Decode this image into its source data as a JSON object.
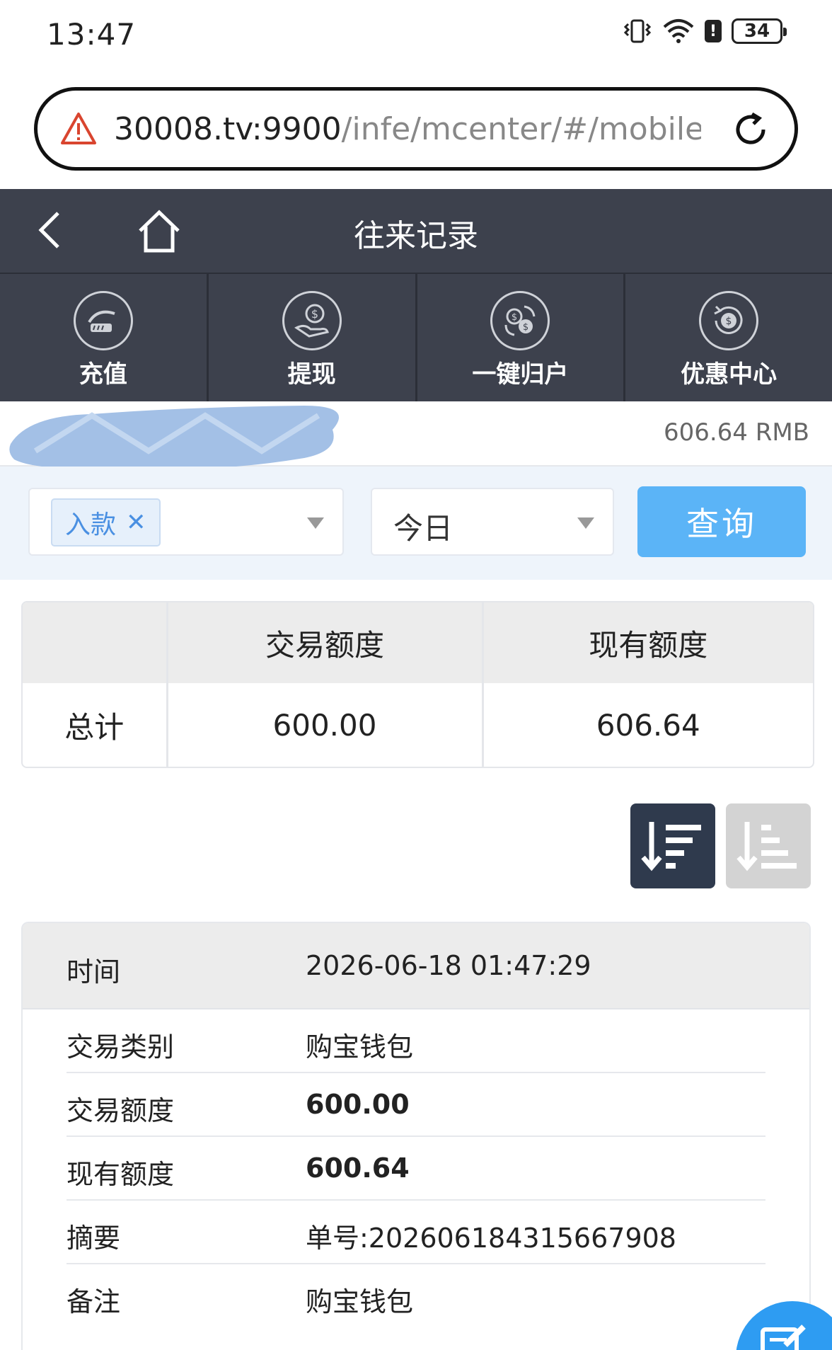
{
  "status_bar": {
    "time": "13:47",
    "battery": "34",
    "icons": [
      "vibrate-icon",
      "wifi-icon",
      "alert-icon",
      "battery-icon"
    ]
  },
  "browser": {
    "url_host": "30008.tv:9900",
    "url_path": "/infe/mcenter/#/mobile/",
    "icons": [
      "warning-icon",
      "reload-icon"
    ]
  },
  "header": {
    "title": "往来记录",
    "icons": [
      "back-icon",
      "home-icon"
    ]
  },
  "actions": [
    {
      "label": "充值",
      "icon": "deposit-icon"
    },
    {
      "label": "提现",
      "icon": "withdraw-icon"
    },
    {
      "label": "一键归户",
      "icon": "transfer-icon"
    },
    {
      "label": "优惠中心",
      "icon": "promo-icon"
    }
  ],
  "account": {
    "balance": "606.64 RMB"
  },
  "filters": {
    "type_tag": "入款",
    "tag_remove": "✕",
    "period": "今日",
    "query_label": "查询"
  },
  "summary": {
    "headers": [
      "",
      "交易额度",
      "现有额度"
    ],
    "row_label": "总计",
    "trade_amount": "600.00",
    "current_amount": "606.64"
  },
  "sort": {
    "icons": [
      "sort-descending-icon",
      "sort-ascending-icon"
    ]
  },
  "record": {
    "time_label": "时间",
    "time_value": "2026-06-18 01:47:29",
    "rows": [
      {
        "label": "交易类别",
        "value": "购宝钱包"
      },
      {
        "label": "交易额度",
        "value": "600.00"
      },
      {
        "label": "现有额度",
        "value": "600.64"
      },
      {
        "label": "摘要",
        "value": "单号:202606184315667908"
      },
      {
        "label": "备注",
        "value": "购宝钱包"
      }
    ]
  },
  "colors": {
    "header_bg": "#3d414d",
    "primary": "#5bb4f7",
    "tag": "#4a90e2",
    "sort_active": "#2f3a4d"
  }
}
